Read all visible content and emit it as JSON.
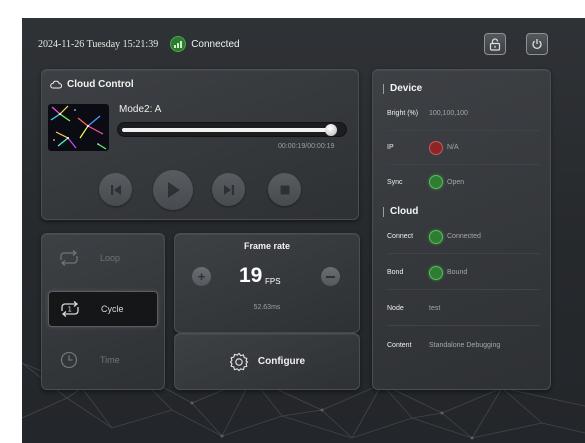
{
  "topbar": {
    "datetime": "2024-11-26 Tuesday 15:21:39",
    "connection": "Connected"
  },
  "cloud_control": {
    "title": "Cloud Control",
    "mode": "Mode2: A",
    "progress": 0.95,
    "time": "00:00:19/00:00:19"
  },
  "modes": {
    "loop": "Loop",
    "cycle": "Cycle",
    "time": "Time",
    "active": "Cycle"
  },
  "frame_rate": {
    "title": "Frame rate",
    "value": "19",
    "unit": "FPS",
    "interval": "52.63ms"
  },
  "configure": {
    "label": "Configure"
  },
  "device": {
    "title": "Device",
    "bright_label": "Bright (%)",
    "bright_value": "100,100,100",
    "ip_label": "IP",
    "ip_value": "N/A",
    "sync_label": "Sync",
    "sync_value": "Open"
  },
  "cloud": {
    "title": "Cloud",
    "connect_label": "Connect",
    "connect_value": "Connected",
    "bond_label": "Bond",
    "bond_value": "Bound",
    "node_label": "Node",
    "node_value": "test",
    "content_label": "Content",
    "content_value": "Standalone Debugging"
  },
  "icons": {
    "connection": "signal-bars-icon",
    "lock": "lock-icon",
    "power": "power-icon",
    "cloud": "cloud-icon",
    "prev": "skip-previous-icon",
    "play": "play-icon",
    "next": "skip-next-icon",
    "stop": "stop-icon",
    "loop": "loop-icon",
    "cycle": "cycle-icon",
    "time": "clock-icon",
    "minus": "minus-icon",
    "plus": "plus-icon",
    "configure": "gear-icon"
  },
  "colors": {
    "status_green": "#2e7d32",
    "status_red": "#8e2525",
    "background": "#2b2e31"
  }
}
